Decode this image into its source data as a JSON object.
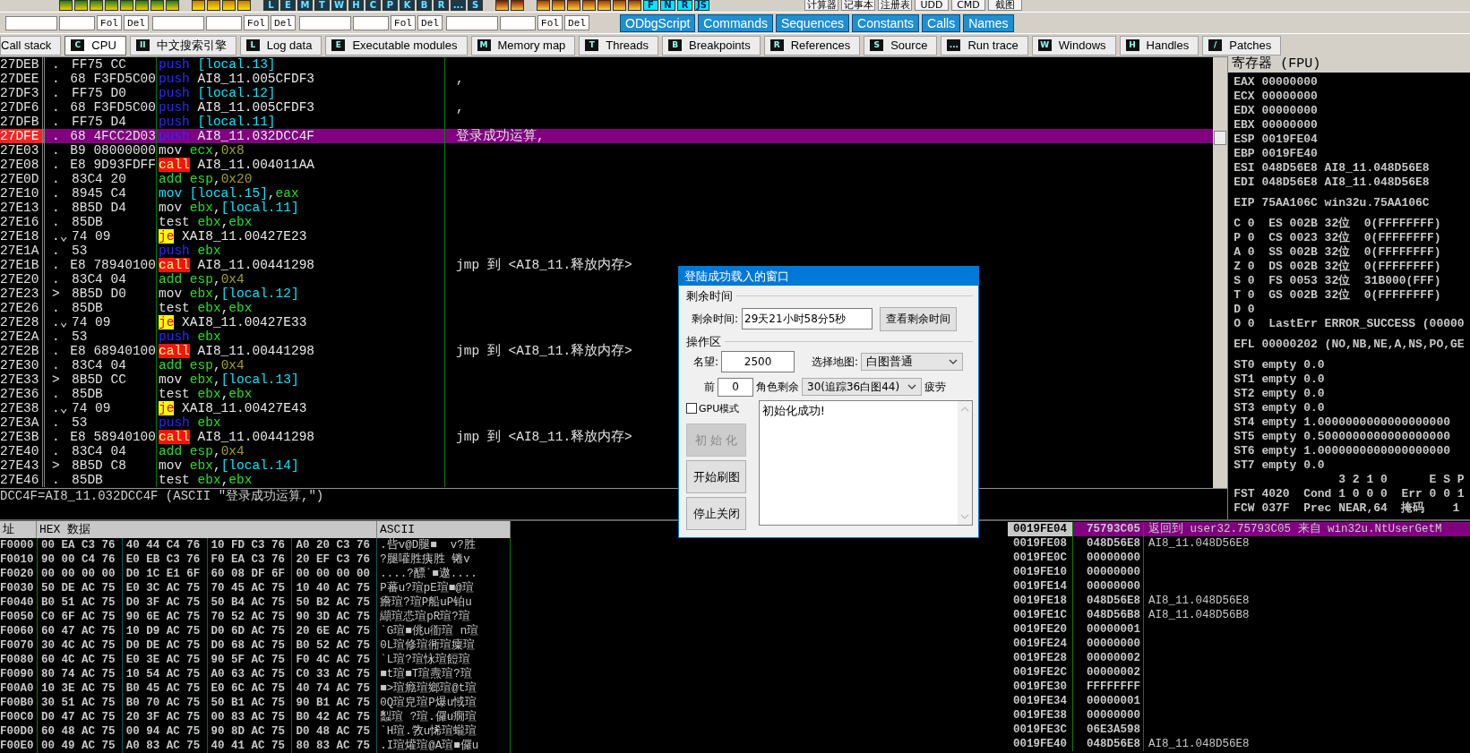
{
  "toolbar_row_1": {
    "groups": [
      [
        {
          "kind": "icon"
        },
        {
          "kind": "icon"
        },
        {
          "kind": "icon"
        },
        {
          "kind": "icon"
        },
        {
          "kind": "icon"
        },
        {
          "kind": "icon"
        },
        {
          "kind": "icon"
        },
        {
          "kind": "icon"
        }
      ],
      [
        {
          "kind": "icon"
        },
        {
          "kind": "icon"
        },
        {
          "kind": "icon"
        },
        {
          "kind": "icon"
        }
      ],
      [
        {
          "kind": "letter",
          "label": "L"
        },
        {
          "kind": "letter",
          "label": "E"
        },
        {
          "kind": "letter",
          "label": "M"
        },
        {
          "kind": "letter",
          "label": "T"
        },
        {
          "kind": "letter",
          "label": "W"
        },
        {
          "kind": "letter",
          "label": "H"
        },
        {
          "kind": "letter",
          "label": "C"
        },
        {
          "kind": "letter",
          "label": "P"
        },
        {
          "kind": "letter",
          "label": "K"
        },
        {
          "kind": "letter",
          "label": "B"
        },
        {
          "kind": "letter",
          "label": "R"
        },
        {
          "kind": "letter",
          "label": "..."
        },
        {
          "kind": "letter",
          "label": "S"
        }
      ],
      [
        {
          "kind": "icon"
        },
        {
          "kind": "icon"
        }
      ],
      [
        {
          "kind": "icon"
        },
        {
          "kind": "icon"
        },
        {
          "kind": "icon"
        },
        {
          "kind": "icon"
        },
        {
          "kind": "icon"
        },
        {
          "kind": "icon"
        },
        {
          "kind": "icon"
        },
        {
          "kind": "plugin",
          "label": "F"
        },
        {
          "kind": "plugin",
          "label": "N"
        },
        {
          "kind": "plugin",
          "label": "R"
        },
        {
          "kind": "plugin",
          "label": "JS"
        }
      ]
    ],
    "tool_buttons": [
      "计算器",
      "记事本",
      "注册表",
      "UDD",
      "CMD",
      "截图"
    ]
  },
  "toolbar_row_2": {
    "search_groups": [
      {
        "buttons": [
          "Fol",
          "Del"
        ]
      },
      {
        "buttons": [
          "Fol",
          "Del"
        ]
      },
      {
        "buttons": [
          "Fol",
          "Del"
        ]
      },
      {
        "buttons": [
          "Fol",
          "Del"
        ]
      }
    ],
    "plugin_buttons": [
      "ODbgScript",
      "Commands",
      "Sequences",
      "Constants",
      "Calls",
      "Names"
    ]
  },
  "tabs": [
    {
      "label": "Call stack",
      "selected": false
    },
    {
      "key": "C",
      "label": "CPU",
      "selected": true
    },
    {
      "key": "II",
      "label": "中文搜索引擎",
      "selected": false
    },
    {
      "key": "L",
      "label": "Log data",
      "selected": false
    },
    {
      "key": "E",
      "label": "Executable modules",
      "selected": false
    },
    {
      "key": "M",
      "label": "Memory map",
      "selected": false
    },
    {
      "key": "T",
      "label": "Threads",
      "selected": false
    },
    {
      "key": "B",
      "label": "Breakpoints",
      "selected": false
    },
    {
      "key": "R",
      "label": "References",
      "selected": false
    },
    {
      "key": "S",
      "label": "Source",
      "selected": false
    },
    {
      "key": "...",
      "label": "Run trace",
      "selected": false
    },
    {
      "key": "W",
      "label": "Windows",
      "selected": false
    },
    {
      "key": "H",
      "label": "Handles",
      "selected": false
    },
    {
      "key": "/",
      "label": "Patches",
      "selected": false
    }
  ],
  "disassembly": {
    "rows": [
      {
        "address": "27DEB",
        "marker": ".",
        "hex": "FF75 CC",
        "op": {
          "text": "push",
          "kind": "push"
        },
        "args": [
          {
            "text": "[local.13]",
            "kind": "mem"
          }
        ],
        "selected": false
      },
      {
        "address": "27DEE",
        "marker": ".",
        "hex": "68 F3FD5C00",
        "op": {
          "text": "push",
          "kind": "push"
        },
        "args": [
          {
            "text": "AI8_11.005CFDF3",
            "kind": "sym"
          }
        ],
        "comment": ",",
        "selected": false
      },
      {
        "address": "27DF3",
        "marker": ".",
        "hex": "FF75 D0",
        "op": {
          "text": "push",
          "kind": "push"
        },
        "args": [
          {
            "text": "[local.12]",
            "kind": "mem"
          }
        ],
        "selected": false
      },
      {
        "address": "27DF6",
        "marker": ".",
        "hex": "68 F3FD5C00",
        "op": {
          "text": "push",
          "kind": "push"
        },
        "args": [
          {
            "text": "AI8_11.005CFDF3",
            "kind": "sym"
          }
        ],
        "comment": ",",
        "selected": false
      },
      {
        "address": "27DFB",
        "marker": ".",
        "hex": "FF75 D4",
        "op": {
          "text": "push",
          "kind": "push"
        },
        "args": [
          {
            "text": "[local.11]",
            "kind": "mem"
          }
        ],
        "selected": false
      },
      {
        "address": "27DFE",
        "marker": ".",
        "hex": "68 4FCC2D03",
        "op": {
          "text": "push",
          "kind": "push"
        },
        "args": [
          {
            "text": "AI8_11.032DCC4F",
            "kind": "sym"
          }
        ],
        "comment": "登录成功运算,",
        "selected": true
      },
      {
        "address": "27E03",
        "marker": ".",
        "hex": "B9 08000000",
        "op": {
          "text": "mov",
          "kind": "op"
        },
        "args": [
          {
            "text": "ecx",
            "kind": "reg"
          },
          {
            "text": ",",
            "kind": "op"
          },
          {
            "text": "0x8",
            "kind": "imm"
          }
        ],
        "selected": false
      },
      {
        "address": "27E08",
        "marker": ".",
        "hex": "E8 9D93FDFF",
        "op": {
          "text": "call",
          "kind": "call"
        },
        "args": [
          {
            "text": "AI8_11.004011AA",
            "kind": "sym"
          }
        ],
        "selected": false
      },
      {
        "address": "27E0D",
        "marker": ".",
        "hex": "83C4 20",
        "op": {
          "text": "add",
          "kind": "reg"
        },
        "args": [
          {
            "text": "esp",
            "kind": "reg"
          },
          {
            "text": ",",
            "kind": "op"
          },
          {
            "text": "0x20",
            "kind": "imm"
          }
        ],
        "selected": false
      },
      {
        "address": "27E10",
        "marker": ".",
        "hex": "8945 C4",
        "op": {
          "text": "mov",
          "kind": "mem"
        },
        "args": [
          {
            "text": "[local.15]",
            "kind": "mem"
          },
          {
            "text": ",",
            "kind": "op"
          },
          {
            "text": "eax",
            "kind": "reg"
          }
        ],
        "selected": false
      },
      {
        "address": "27E13",
        "marker": ".",
        "hex": "8B5D D4",
        "op": {
          "text": "mov",
          "kind": "op"
        },
        "args": [
          {
            "text": "ebx",
            "kind": "reg"
          },
          {
            "text": ",",
            "kind": "op"
          },
          {
            "text": "[local.11]",
            "kind": "mem"
          }
        ],
        "selected": false
      },
      {
        "address": "27E16",
        "marker": ".",
        "hex": "85DB",
        "op": {
          "text": "test",
          "kind": "op"
        },
        "args": [
          {
            "text": "ebx",
            "kind": "reg"
          },
          {
            "text": ",",
            "kind": "op"
          },
          {
            "text": "ebx",
            "kind": "reg"
          }
        ],
        "selected": false
      },
      {
        "address": "27E18",
        "marker": ".⌄",
        "hex": "74 09",
        "op": {
          "text": "je",
          "kind": "jcc"
        },
        "args": [
          {
            "text": "XAI8_11.00427E23",
            "kind": "sym"
          }
        ],
        "selected": false
      },
      {
        "address": "27E1A",
        "marker": ".",
        "hex": "53",
        "op": {
          "text": "push",
          "kind": "push"
        },
        "args": [
          {
            "text": "ebx",
            "kind": "reg"
          }
        ],
        "selected": false
      },
      {
        "address": "27E1B",
        "marker": ".",
        "hex": "E8 78940100",
        "op": {
          "text": "call",
          "kind": "call"
        },
        "args": [
          {
            "text": "AI8_11.00441298",
            "kind": "sym"
          }
        ],
        "comment": "jmp 到 <AI8_11.释放内存>",
        "selected": false
      },
      {
        "address": "27E20",
        "marker": ".",
        "hex": "83C4 04",
        "op": {
          "text": "add",
          "kind": "reg"
        },
        "args": [
          {
            "text": "esp",
            "kind": "reg"
          },
          {
            "text": ",",
            "kind": "op"
          },
          {
            "text": "0x4",
            "kind": "imm"
          }
        ],
        "selected": false
      },
      {
        "address": "27E23",
        "marker": ">",
        "hex": "8B5D D0",
        "op": {
          "text": "mov",
          "kind": "op"
        },
        "args": [
          {
            "text": "ebx",
            "kind": "reg"
          },
          {
            "text": ",",
            "kind": "op"
          },
          {
            "text": "[local.12]",
            "kind": "mem"
          }
        ],
        "selected": false
      },
      {
        "address": "27E26",
        "marker": ".",
        "hex": "85DB",
        "op": {
          "text": "test",
          "kind": "op"
        },
        "args": [
          {
            "text": "ebx",
            "kind": "reg"
          },
          {
            "text": ",",
            "kind": "op"
          },
          {
            "text": "ebx",
            "kind": "reg"
          }
        ],
        "selected": false
      },
      {
        "address": "27E28",
        "marker": ".⌄",
        "hex": "74 09",
        "op": {
          "text": "je",
          "kind": "jcc"
        },
        "args": [
          {
            "text": "XAI8_11.00427E33",
            "kind": "sym"
          }
        ],
        "selected": false
      },
      {
        "address": "27E2A",
        "marker": ".",
        "hex": "53",
        "op": {
          "text": "push",
          "kind": "push"
        },
        "args": [
          {
            "text": "ebx",
            "kind": "reg"
          }
        ],
        "selected": false
      },
      {
        "address": "27E2B",
        "marker": ".",
        "hex": "E8 68940100",
        "op": {
          "text": "call",
          "kind": "call"
        },
        "args": [
          {
            "text": "AI8_11.00441298",
            "kind": "sym"
          }
        ],
        "comment": "jmp 到 <AI8_11.释放内存>",
        "selected": false
      },
      {
        "address": "27E30",
        "marker": ".",
        "hex": "83C4 04",
        "op": {
          "text": "add",
          "kind": "reg"
        },
        "args": [
          {
            "text": "esp",
            "kind": "reg"
          },
          {
            "text": ",",
            "kind": "op"
          },
          {
            "text": "0x4",
            "kind": "imm"
          }
        ],
        "selected": false
      },
      {
        "address": "27E33",
        "marker": ">",
        "hex": "8B5D CC",
        "op": {
          "text": "mov",
          "kind": "op"
        },
        "args": [
          {
            "text": "ebx",
            "kind": "reg"
          },
          {
            "text": ",",
            "kind": "op"
          },
          {
            "text": "[local.13]",
            "kind": "mem"
          }
        ],
        "selected": false
      },
      {
        "address": "27E36",
        "marker": ".",
        "hex": "85DB",
        "op": {
          "text": "test",
          "kind": "op"
        },
        "args": [
          {
            "text": "ebx",
            "kind": "reg"
          },
          {
            "text": ",",
            "kind": "op"
          },
          {
            "text": "ebx",
            "kind": "reg"
          }
        ],
        "selected": false
      },
      {
        "address": "27E38",
        "marker": ".⌄",
        "hex": "74 09",
        "op": {
          "text": "je",
          "kind": "jcc"
        },
        "args": [
          {
            "text": "XAI8_11.00427E43",
            "kind": "sym"
          }
        ],
        "selected": false
      },
      {
        "address": "27E3A",
        "marker": ".",
        "hex": "53",
        "op": {
          "text": "push",
          "kind": "push"
        },
        "args": [
          {
            "text": "ebx",
            "kind": "reg"
          }
        ],
        "selected": false
      },
      {
        "address": "27E3B",
        "marker": ".",
        "hex": "E8 58940100",
        "op": {
          "text": "call",
          "kind": "call"
        },
        "args": [
          {
            "text": "AI8_11.00441298",
            "kind": "sym"
          }
        ],
        "comment": "jmp 到 <AI8_11.释放内存>",
        "selected": false
      },
      {
        "address": "27E40",
        "marker": ".",
        "hex": "83C4 04",
        "op": {
          "text": "add",
          "kind": "reg"
        },
        "args": [
          {
            "text": "esp",
            "kind": "reg"
          },
          {
            "text": ",",
            "kind": "op"
          },
          {
            "text": "0x4",
            "kind": "imm"
          }
        ],
        "selected": false
      },
      {
        "address": "27E43",
        "marker": ">",
        "hex": "8B5D C8",
        "op": {
          "text": "mov",
          "kind": "op"
        },
        "args": [
          {
            "text": "ebx",
            "kind": "reg"
          },
          {
            "text": ",",
            "kind": "op"
          },
          {
            "text": "[local.14]",
            "kind": "mem"
          }
        ],
        "selected": false
      },
      {
        "address": "27E46",
        "marker": ".",
        "hex": "85DB",
        "op": {
          "text": "test",
          "kind": "op"
        },
        "args": [
          {
            "text": "ebx",
            "kind": "reg"
          },
          {
            "text": ",",
            "kind": "op"
          },
          {
            "text": "ebx",
            "kind": "reg"
          }
        ],
        "selected": false
      }
    ],
    "info_line": "DCC4F=AI8_11.032DCC4F (ASCII \"登录成功运算,\")"
  },
  "registers": {
    "title": "寄存器 (FPU)",
    "groups": [
      [
        "EAX 00000000",
        "ECX 00000000",
        "EDX 00000000",
        "EBX 00000000",
        "ESP 0019FE04",
        "EBP 0019FE40",
        "ESI 048D56E8 AI8_11.048D56E8",
        "EDI 048D56E8 AI8_11.048D56E8"
      ],
      [
        "EIP 75AA106C win32u.75AA106C"
      ],
      [
        "C 0  ES 002B 32位  0(FFFFFFFF)",
        "P 0  CS 0023 32位  0(FFFFFFFF)",
        "A 0  SS 002B 32位  0(FFFFFFFF)",
        "Z 0  DS 002B 32位  0(FFFFFFFF)",
        "S 0  FS 0053 32位  31B000(FFF)",
        "T 0  GS 002B 32位  0(FFFFFFFF)",
        "D 0",
        "O 0  LastErr ERROR_SUCCESS (00000"
      ],
      [
        "EFL 00000202 (NO,NB,NE,A,NS,PO,GE"
      ],
      [
        "ST0 empty 0.0",
        "ST1 empty 0.0",
        "ST2 empty 0.0",
        "ST3 empty 0.0",
        "ST4 empty 1.0000000000000000000",
        "ST5 empty 0.5000000000000000000",
        "ST6 empty 1.0000000000000000000",
        "ST7 empty 0.0",
        "               3 2 1 0      E S P",
        "FST 4020  Cond 1 0 0 0  Err 0 0 1",
        "FCW 037F  Prec NEAR,64  掩码    1"
      ]
    ]
  },
  "dump": {
    "columns": [
      "址",
      "HEX 数据",
      "ASCII"
    ],
    "rows": [
      {
        "address": "F0000",
        "bytes": [
          "00 EA C3 76",
          "40 44 C4 76",
          "10 FD C3 76",
          "A0 20 C3 76"
        ],
        "ascii": ".呰v@D腿■  v?胜"
      },
      {
        "address": "F0010",
        "bytes": [
          "90 00 C4 76",
          "E0 EB C3 76",
          "F0 EA C3 76",
          "20 EF C3 76"
        ],
        "ascii": "?腿嚾胜痍胜 锩v"
      },
      {
        "address": "F0020",
        "bytes": [
          "00 00 00 00",
          "D0 1C E1 6F",
          "60 08 DF 6F",
          "00 00 00 00"
        ],
        "ascii": "....?醥`■遨...."
      },
      {
        "address": "F0030",
        "bytes": [
          "50 DE AC 75",
          "E0 3C AC 75",
          "70 45 AC 75",
          "10 40 AC 75"
        ],
        "ascii": "P蕃u?瑄pE瑄■@瑄"
      },
      {
        "address": "F0040",
        "bytes": [
          "B0 51 AC 75",
          "D0 3F AC 75",
          "50 B4 AC 75",
          "50 B2 AC 75"
        ],
        "ascii": "癚瑄?瑄P船uP铂u"
      },
      {
        "address": "F0050",
        "bytes": [
          "C0 6F AC 75",
          "90 6E AC 75",
          "70 52 AC 75",
          "90 3D AC 75"
        ],
        "ascii": "纈瑄怷瑄pR瑄?瑄"
      },
      {
        "address": "F0060",
        "bytes": [
          "60 47 AC 75",
          "10 D9 AC 75",
          "D0 6D AC 75",
          "20 6E AC 75"
        ],
        "ascii": "`G瑄■佻u衜瑄 n瑄"
      },
      {
        "address": "F0070",
        "bytes": [
          "30 4C AC 75",
          "D0 DE AC 75",
          "D0 68 AC 75",
          "B0 52 AC 75"
        ],
        "ascii": "0L瑄修瑄衕瑄癛瑄"
      },
      {
        "address": "F0080",
        "bytes": [
          "60 4C AC 75",
          "E0 3E AC 75",
          "90 5F AC 75",
          "F0 4C AC 75"
        ],
        "ascii": "`L瑄?瑄怺瑄餖瑄"
      },
      {
        "address": "F0090",
        "bytes": [
          "80 74 AC 75",
          "10 54 AC 75",
          "A0 63 AC 75",
          "C0 33 AC 75"
        ],
        "ascii": "■t瑄■T瑄燾瑄?瑄"
      },
      {
        "address": "F00A0",
        "bytes": [
          "10 3E AC 75",
          "B0 45 AC 75",
          "E0 6C AC 75",
          "40 74 AC 75"
        ],
        "ascii": "■>瑄癊瑄鄉瑄@t瑄"
      },
      {
        "address": "F00B0",
        "bytes": [
          "30 51 AC 75",
          "B0 70 AC 75",
          "50 B1 AC 75",
          "90 B1 AC 75"
        ],
        "ascii": "0Q瑄皃瑄P爆u惐瑄"
      },
      {
        "address": "F00C0",
        "bytes": [
          "D0 47 AC 75",
          "20 3F AC 75",
          "00 83 AC 75",
          "B0 42 AC 75"
        ],
        "ascii": "蠫瑄 ?瑄.儸u癇瑄"
      },
      {
        "address": "F00D0",
        "bytes": [
          "60 48 AC 75",
          "00 94 AC 75",
          "90 8D AC 75",
          "D0 48 AC 75"
        ],
        "ascii": "`H瑄.敩u悕瑄蠬瑄"
      },
      {
        "address": "F00E0",
        "bytes": [
          "00 49 AC 75",
          "A0 83 AC 75",
          "40 41 AC 75",
          "80 83 AC 75"
        ],
        "ascii": ".I瑄爟瑄@A瑄■儸u"
      }
    ]
  },
  "stack": {
    "rows": [
      {
        "address": "0019FE04",
        "value": "75793C05",
        "comment": "返回到 user32.75793C05 来自 win32u.NtUserGetM",
        "selected": true
      },
      {
        "address": "0019FE08",
        "value": "048D56E8",
        "comment": "AI8_11.048D56E8",
        "selected": false
      },
      {
        "address": "0019FE0C",
        "value": "00000000",
        "selected": false
      },
      {
        "address": "0019FE10",
        "value": "00000000",
        "selected": false
      },
      {
        "address": "0019FE14",
        "value": "00000000",
        "selected": false
      },
      {
        "address": "0019FE18",
        "value": "048D56E8",
        "comment": "AI8_11.048D56E8",
        "selected": false
      },
      {
        "address": "0019FE1C",
        "value": "048D56B8",
        "comment": "AI8_11.048D56B8",
        "selected": false
      },
      {
        "address": "0019FE20",
        "value": "00000001",
        "selected": false
      },
      {
        "address": "0019FE24",
        "value": "00000000",
        "selected": false
      },
      {
        "address": "0019FE28",
        "value": "00000002",
        "selected": false
      },
      {
        "address": "0019FE2C",
        "value": "00000002",
        "selected": false
      },
      {
        "address": "0019FE30",
        "value": "FFFFFFFF",
        "selected": false
      },
      {
        "address": "0019FE34",
        "value": "00000001",
        "selected": false
      },
      {
        "address": "0019FE38",
        "value": "00000000",
        "selected": false
      },
      {
        "address": "0019FE3C",
        "value": "06E3A598",
        "selected": false
      },
      {
        "address": "0019FE40",
        "value": "048D56E8",
        "comment": "AI8_11.048D56E8",
        "selected": false
      }
    ]
  },
  "dialog": {
    "title": "登陆成功载入的窗口",
    "time_group": {
      "label": "剩余时间",
      "field_label": "剩余时间:",
      "field_value": "29天21小时58分5秒",
      "button": "查看剩余时间"
    },
    "ops_group": {
      "label": "操作区",
      "fame_label": "名望:",
      "fame_value": "2500",
      "map_label": "选择地图:",
      "map_value": "白图普通",
      "front_label": "前",
      "front_value": "0",
      "remain_label": "角色剩余",
      "remain_value": "30(追踪36白图44)",
      "fatigue_label": "疲劳"
    },
    "gpu_checkbox": {
      "label": "GPU模式",
      "checked": false
    },
    "buttons": [
      {
        "label": "初 始 化",
        "disabled": true
      },
      {
        "label": "开始刷图",
        "disabled": false
      },
      {
        "label": "停止关闭",
        "disabled": false
      }
    ],
    "log_text": "初始化成功!"
  }
}
